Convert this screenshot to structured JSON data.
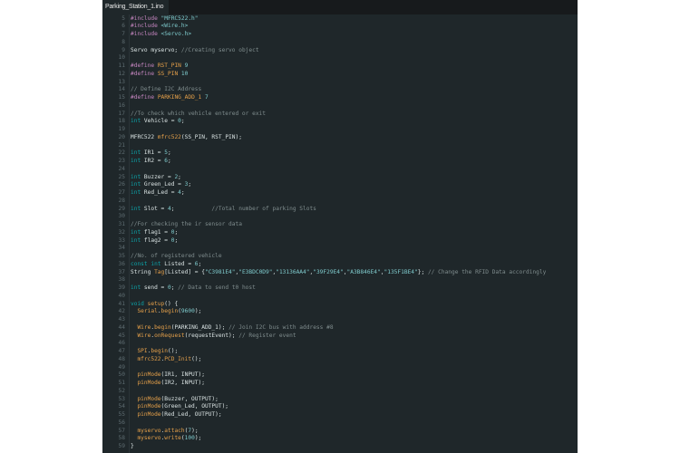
{
  "tab": {
    "label": "Parking_Station_1.ino"
  },
  "colors": {
    "background": "#1f272a",
    "keyword": "#0ca1a6",
    "preprocessor": "#c586c0",
    "function": "#e5a04a",
    "literal": "#7fcbcd",
    "comment": "#7f8c8d",
    "text": "#dae3e3"
  },
  "lines": [
    {
      "n": "5",
      "t": [
        [
          "#include ",
          "pp"
        ],
        [
          "\"MFRC522.h\"",
          "str"
        ]
      ]
    },
    {
      "n": "6",
      "t": [
        [
          "#include ",
          "pp"
        ],
        [
          "<Wire.h>",
          "str"
        ]
      ]
    },
    {
      "n": "7",
      "t": [
        [
          "#include ",
          "pp"
        ],
        [
          "<Servo.h>",
          "str"
        ]
      ]
    },
    {
      "n": "8",
      "t": []
    },
    {
      "n": "9",
      "t": [
        [
          "Servo myservo; ",
          "txt"
        ],
        [
          "//Creating servo object",
          "cm"
        ]
      ]
    },
    {
      "n": "10",
      "t": []
    },
    {
      "n": "11",
      "t": [
        [
          "#define ",
          "pp"
        ],
        [
          "RST_PIN ",
          "fn"
        ],
        [
          "9",
          "num"
        ]
      ]
    },
    {
      "n": "12",
      "t": [
        [
          "#define ",
          "pp"
        ],
        [
          "SS_PIN ",
          "fn"
        ],
        [
          "10",
          "num"
        ]
      ]
    },
    {
      "n": "13",
      "t": []
    },
    {
      "n": "14",
      "t": [
        [
          "// Define I2C Address",
          "cm"
        ]
      ]
    },
    {
      "n": "15",
      "t": [
        [
          "#define ",
          "pp"
        ],
        [
          "PARKING_ADD_1 ",
          "fn"
        ],
        [
          "7",
          "num"
        ]
      ]
    },
    {
      "n": "16",
      "t": []
    },
    {
      "n": "17",
      "t": [
        [
          "//To check which vehicle entered or exit",
          "cm"
        ]
      ]
    },
    {
      "n": "18",
      "t": [
        [
          "int ",
          "kw"
        ],
        [
          "Vehicle = ",
          "txt"
        ],
        [
          "0",
          "num"
        ],
        [
          ";",
          "txt"
        ]
      ]
    },
    {
      "n": "19",
      "t": []
    },
    {
      "n": "20",
      "t": [
        [
          "MFRC522 ",
          "txt"
        ],
        [
          "mfrc522",
          "fn"
        ],
        [
          "(SS_PIN, RST_PIN);",
          "txt"
        ]
      ]
    },
    {
      "n": "21",
      "t": []
    },
    {
      "n": "22",
      "t": [
        [
          "int ",
          "kw"
        ],
        [
          "IR1 = ",
          "txt"
        ],
        [
          "5",
          "num"
        ],
        [
          ";",
          "txt"
        ]
      ]
    },
    {
      "n": "23",
      "t": [
        [
          "int ",
          "kw"
        ],
        [
          "IR2 = ",
          "txt"
        ],
        [
          "6",
          "num"
        ],
        [
          ";",
          "txt"
        ]
      ]
    },
    {
      "n": "24",
      "t": []
    },
    {
      "n": "25",
      "t": [
        [
          "int ",
          "kw"
        ],
        [
          "Buzzer = ",
          "txt"
        ],
        [
          "2",
          "num"
        ],
        [
          ";",
          "txt"
        ]
      ]
    },
    {
      "n": "26",
      "t": [
        [
          "int ",
          "kw"
        ],
        [
          "Green_Led = ",
          "txt"
        ],
        [
          "3",
          "num"
        ],
        [
          ";",
          "txt"
        ]
      ]
    },
    {
      "n": "27",
      "t": [
        [
          "int ",
          "kw"
        ],
        [
          "Red_Led = ",
          "txt"
        ],
        [
          "4",
          "num"
        ],
        [
          ";",
          "txt"
        ]
      ]
    },
    {
      "n": "28",
      "t": []
    },
    {
      "n": "29",
      "t": [
        [
          "int ",
          "kw"
        ],
        [
          "Slot = ",
          "txt"
        ],
        [
          "4",
          "num"
        ],
        [
          ";           ",
          "txt"
        ],
        [
          "//Total number of parking Slots",
          "cm"
        ]
      ]
    },
    {
      "n": "30",
      "t": []
    },
    {
      "n": "31",
      "t": [
        [
          "//For checking the ir sensor data",
          "cm"
        ]
      ]
    },
    {
      "n": "32",
      "t": [
        [
          "int ",
          "kw"
        ],
        [
          "flag1 = ",
          "txt"
        ],
        [
          "0",
          "num"
        ],
        [
          ";",
          "txt"
        ]
      ]
    },
    {
      "n": "33",
      "t": [
        [
          "int ",
          "kw"
        ],
        [
          "flag2 = ",
          "txt"
        ],
        [
          "0",
          "num"
        ],
        [
          ";",
          "txt"
        ]
      ]
    },
    {
      "n": "34",
      "t": []
    },
    {
      "n": "35",
      "t": [
        [
          "//No. of registered vehicle",
          "cm"
        ]
      ]
    },
    {
      "n": "36",
      "t": [
        [
          "const int ",
          "kw"
        ],
        [
          "Listed = ",
          "txt"
        ],
        [
          "6",
          "num"
        ],
        [
          ";",
          "txt"
        ]
      ]
    },
    {
      "n": "37",
      "t": [
        [
          "String ",
          "txt"
        ],
        [
          "Tag",
          "fn"
        ],
        [
          "[Listed] = {",
          "txt"
        ],
        [
          "\"C3981E4\"",
          "str"
        ],
        [
          ",",
          "txt"
        ],
        [
          "\"E3BDC0D9\"",
          "str"
        ],
        [
          ",",
          "txt"
        ],
        [
          "\"13136AA4\"",
          "str"
        ],
        [
          ",",
          "txt"
        ],
        [
          "\"39F29E4\"",
          "str"
        ],
        [
          ",",
          "txt"
        ],
        [
          "\"A3B846E4\"",
          "str"
        ],
        [
          ",",
          "txt"
        ],
        [
          "\"135F1BE4\"",
          "str"
        ],
        [
          "}; ",
          "txt"
        ],
        [
          "// Change the RFID Data accordingly",
          "cm"
        ]
      ]
    },
    {
      "n": "38",
      "t": []
    },
    {
      "n": "39",
      "t": [
        [
          "int ",
          "kw"
        ],
        [
          "send = ",
          "txt"
        ],
        [
          "0",
          "num"
        ],
        [
          "; ",
          "txt"
        ],
        [
          "// Data to send t0 host",
          "cm"
        ]
      ]
    },
    {
      "n": "40",
      "t": []
    },
    {
      "n": "41",
      "t": [
        [
          "void ",
          "kw"
        ],
        [
          "setup",
          "fn"
        ],
        [
          "() {",
          "txt"
        ]
      ]
    },
    {
      "n": "42",
      "t": [
        [
          "  Serial",
          "fn"
        ],
        [
          ".",
          "txt"
        ],
        [
          "begin",
          "fn"
        ],
        [
          "(",
          "txt"
        ],
        [
          "9600",
          "num"
        ],
        [
          ");",
          "txt"
        ]
      ]
    },
    {
      "n": "43",
      "t": []
    },
    {
      "n": "44",
      "t": [
        [
          "  Wire",
          "fn"
        ],
        [
          ".",
          "txt"
        ],
        [
          "begin",
          "fn"
        ],
        [
          "(PARKING_ADD_1); ",
          "txt"
        ],
        [
          "// Join I2C bus with address #8",
          "cm"
        ]
      ]
    },
    {
      "n": "45",
      "t": [
        [
          "  Wire",
          "fn"
        ],
        [
          ".",
          "txt"
        ],
        [
          "onRequest",
          "fn"
        ],
        [
          "(requestEvent); ",
          "txt"
        ],
        [
          "// Register event",
          "cm"
        ]
      ]
    },
    {
      "n": "46",
      "t": []
    },
    {
      "n": "47",
      "t": [
        [
          "  SPI",
          "fn"
        ],
        [
          ".",
          "txt"
        ],
        [
          "begin",
          "fn"
        ],
        [
          "();",
          "txt"
        ]
      ]
    },
    {
      "n": "48",
      "t": [
        [
          "  mfrc522",
          "fn"
        ],
        [
          ".",
          "txt"
        ],
        [
          "PCD_Init",
          "fn"
        ],
        [
          "();",
          "txt"
        ]
      ]
    },
    {
      "n": "49",
      "t": []
    },
    {
      "n": "50",
      "t": [
        [
          "  pinMode",
          "fn"
        ],
        [
          "(IR1, INPUT);",
          "txt"
        ]
      ]
    },
    {
      "n": "51",
      "t": [
        [
          "  pinMode",
          "fn"
        ],
        [
          "(IR2, INPUT);",
          "txt"
        ]
      ]
    },
    {
      "n": "52",
      "t": []
    },
    {
      "n": "53",
      "t": [
        [
          "  pinMode",
          "fn"
        ],
        [
          "(Buzzer, OUTPUT);",
          "txt"
        ]
      ]
    },
    {
      "n": "54",
      "t": [
        [
          "  pinMode",
          "fn"
        ],
        [
          "(Green_Led, OUTPUT);",
          "txt"
        ]
      ]
    },
    {
      "n": "55",
      "t": [
        [
          "  pinMode",
          "fn"
        ],
        [
          "(Red_Led, OUTPUT);",
          "txt"
        ]
      ]
    },
    {
      "n": "56",
      "t": []
    },
    {
      "n": "57",
      "t": [
        [
          "  myservo",
          "fn"
        ],
        [
          ".",
          "txt"
        ],
        [
          "attach",
          "fn"
        ],
        [
          "(",
          "txt"
        ],
        [
          "7",
          "num"
        ],
        [
          ");",
          "txt"
        ]
      ]
    },
    {
      "n": "58",
      "t": [
        [
          "  myservo",
          "fn"
        ],
        [
          ".",
          "txt"
        ],
        [
          "write",
          "fn"
        ],
        [
          "(",
          "txt"
        ],
        [
          "100",
          "num"
        ],
        [
          ");",
          "txt"
        ]
      ]
    },
    {
      "n": "59",
      "t": [
        [
          "}",
          "txt"
        ]
      ]
    }
  ]
}
